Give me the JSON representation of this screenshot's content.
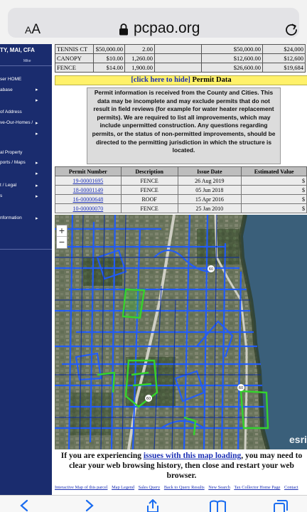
{
  "browser": {
    "text_size_label_small": "A",
    "text_size_label_big": "A",
    "url": "pcpao.org",
    "lock_icon": "lock-icon",
    "reload_icon": "reload-icon"
  },
  "sidebar": {
    "brand": "TY, MAI, CFA",
    "brand_sub": "Mike",
    "items": [
      {
        "label": "ser HOME",
        "arrow": ""
      },
      {
        "label": "abase",
        "arrow": "▸"
      },
      {
        "label": "",
        "arrow": "▸"
      },
      {
        "label": "of Address",
        "arrow": ""
      },
      {
        "label": "ve-Our-Homes /",
        "arrow": "▸"
      },
      {
        "label": "",
        "arrow": "▸"
      },
      {
        "label": "al Property",
        "arrow": ""
      },
      {
        "label": "ports / Maps",
        "arrow": "▸"
      },
      {
        "label": "",
        "arrow": "▸"
      },
      {
        "label": "t / Legal",
        "arrow": "▸"
      },
      {
        "label": "s",
        "arrow": "▸"
      },
      {
        "label": "nformation",
        "arrow": "▸"
      }
    ]
  },
  "features": [
    [
      "TENNIS CT",
      "$50,000.00",
      "2.00",
      "",
      "$50,000.00",
      "$24,000"
    ],
    [
      "CANOPY",
      "$10.00",
      "1,260.00",
      "",
      "$12,600.00",
      "$12,600"
    ],
    [
      "FENCE",
      "$14.00",
      "1,900.00",
      "",
      "$26,600.00",
      "$19,684"
    ]
  ],
  "permit_section": {
    "hide_link": "[click here to hide]",
    "title": " Permit Data",
    "notice": "Permit information is received from the County and Cities. This data may be incomplete and may exclude permits that do not result in field reviews (for example for water heater replacement permits). We are required to list all improvements, which may include unpermitted construction. Any questions regarding permits, or the status of non-permitted improvements, should be directed to the permitting jurisdiction in which the structure is located.",
    "headers": [
      "Permit Number",
      "Description",
      "Issue Date",
      "Estimated Value"
    ],
    "rows": [
      [
        "19-00001695",
        "FENCE",
        "26 Aug 2019",
        "$"
      ],
      [
        "18-00001149",
        "FENCE",
        "05 Jun 2018",
        "$"
      ],
      [
        "16-00000648",
        "ROOF",
        "15 Apr 2016",
        "$"
      ],
      [
        "10-00000070",
        "FENCE",
        "25 Jan 2010",
        "$"
      ]
    ]
  },
  "map": {
    "zoom_in": "+",
    "zoom_out": "−",
    "attribution": "esri",
    "shield_labels": [
      "60",
      "60",
      "60"
    ],
    "colors": {
      "water": "#3a5f7a",
      "parcel_line": "#1f5bff",
      "highlight": "#35d42b"
    }
  },
  "map_note": {
    "prefix": "If you are experiencing ",
    "link": "issues with this map loading",
    "suffix": ", you may need to clear your web browsing history, then close and restart your web browser."
  },
  "footer_links": [
    "Interactive Map of this parcel",
    "Map Legend",
    "Sales Query",
    "Back to Query Results",
    "New Search",
    "Tax Collector Home Page",
    "Contact"
  ]
}
